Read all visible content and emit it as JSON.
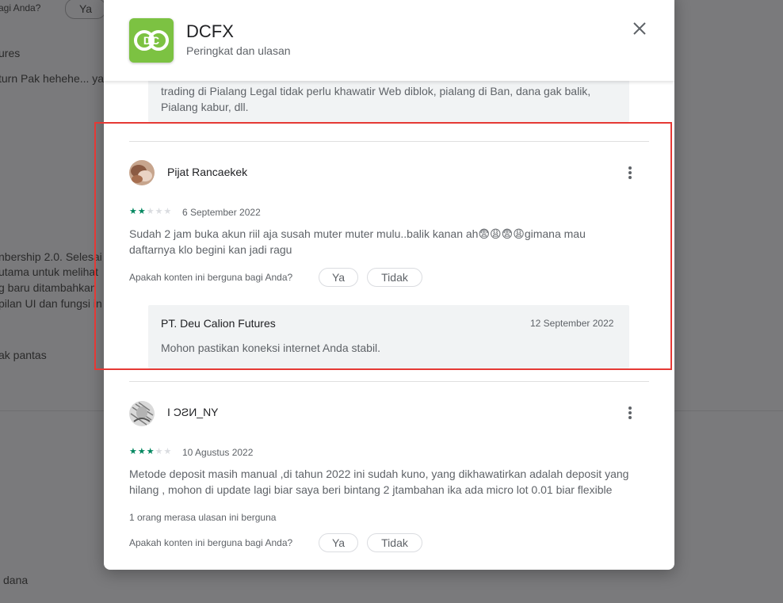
{
  "background": {
    "t1": "agi Anda?",
    "pill_ya": "Ya",
    "t2": "ures",
    "t3": "turn Pak hehehe... ya",
    "t4": "nbership 2.0. Selesai",
    "t5": "utama untuk melihat",
    "t6": "g baru ditambahkan",
    "t7": "pilan UI dan fungsi in",
    "t8": "ak pantas",
    "t9": "dana"
  },
  "header": {
    "icon_name": "dcfx-logo-icon",
    "icon_text": "DC",
    "app_title": "DCFX",
    "subtitle": "Peringkat dan ulasan",
    "close_icon": "close-icon"
  },
  "prev_reply": {
    "line1": "trading di Pialang Legal tidak perlu khawatir Web diblok, pialang di Ban, dana gak balik,",
    "line2": "Pialang kabur, dll."
  },
  "reviews": [
    {
      "name": "Pijat Rancaekek",
      "rating": 2,
      "date": "6 September 2022",
      "text_line1": "Sudah 2 jam buka akun riil aja susah muter muter mulu..balik kanan ah😨😩😨😩gimana mau",
      "text_line2": "daftarnya klo begini kan jadi ragu",
      "helpful_question": "Apakah konten ini berguna bagi Anda?",
      "yes": "Ya",
      "no": "Tidak",
      "reply": {
        "name": "PT. Deu Calion Futures",
        "date": "12 September 2022",
        "text": "Mohon pastikan koneksi internet Anda stabil."
      }
    },
    {
      "name": "I ƆƧИ_NY",
      "rating": 3,
      "date": "10 Agustus 2022",
      "text_line1": "Metode deposit masih manual ,di tahun 2022 ini sudah kuno, yang dikhawatirkan adalah deposit yang",
      "text_line2": "hilang , mohon di update lagi biar saya beri bintang 2 jtambahan ika ada micro lot 0.01 biar flexible",
      "helpful_count": "1 orang merasa ulasan ini berguna",
      "helpful_question": "Apakah konten ini berguna bagi Anda?",
      "yes": "Ya",
      "no": "Tidak"
    }
  ],
  "colors": {
    "star_on": "#01875f",
    "star_off": "#dadce0",
    "app_icon_bg": "#7cc242",
    "highlight": "#e53935"
  }
}
